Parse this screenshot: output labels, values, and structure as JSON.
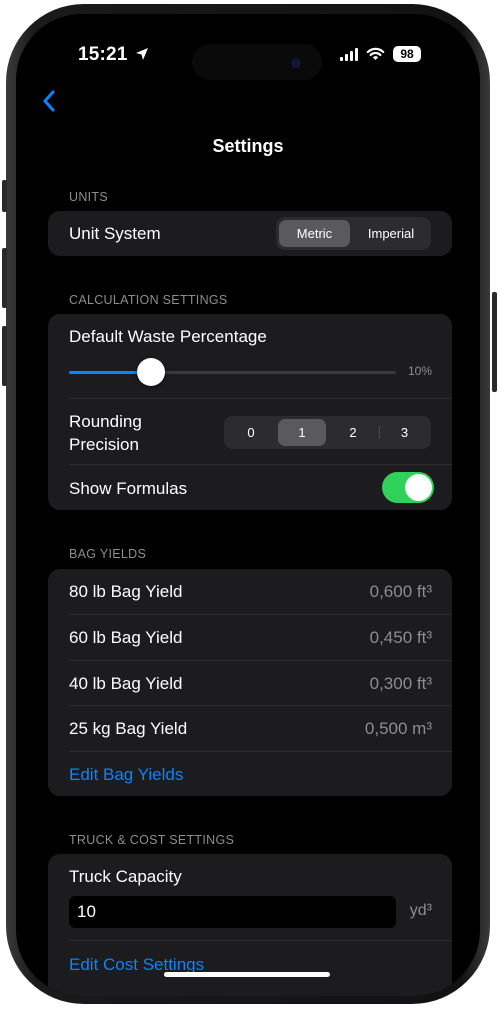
{
  "status": {
    "time": "15:21",
    "battery": "98"
  },
  "nav": {
    "title": "Settings"
  },
  "units": {
    "header": "UNITS",
    "unit_system_label": "Unit System",
    "options": [
      "Metric",
      "Imperial"
    ],
    "selected": "Metric"
  },
  "calculation": {
    "header": "CALCULATION SETTINGS",
    "waste_label": "Default Waste Percentage",
    "waste_value": "10%",
    "waste_fraction": 0.1,
    "rounding_label_line1": "Rounding",
    "rounding_label_line2": "Precision",
    "rounding_options": [
      "0",
      "1",
      "2",
      "3"
    ],
    "rounding_selected": "1",
    "formulas_label": "Show Formulas",
    "formulas_on": true
  },
  "bag_yields": {
    "header": "BAG YIELDS",
    "items": [
      {
        "label": "80 lb Bag Yield",
        "value": "0,600 ft³"
      },
      {
        "label": "60 lb Bag Yield",
        "value": "0,450 ft³"
      },
      {
        "label": "40 lb Bag Yield",
        "value": "0,300 ft³"
      },
      {
        "label": "25 kg Bag Yield",
        "value": "0,500 m³"
      }
    ],
    "edit_link": "Edit Bag Yields"
  },
  "truck": {
    "header": "TRUCK & COST SETTINGS",
    "capacity_label": "Truck Capacity",
    "capacity_value": "10",
    "capacity_unit": "yd³",
    "edit_link": "Edit Cost Settings"
  },
  "colors": {
    "accent": "#0a84ff",
    "toggle_on": "#30d158",
    "card": "#1c1c1e",
    "secondary_text": "#8d8d92"
  }
}
